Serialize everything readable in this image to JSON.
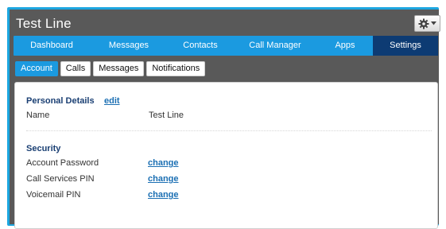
{
  "window": {
    "title": "Test Line"
  },
  "nav": {
    "items": [
      {
        "label": "Dashboard",
        "active": false
      },
      {
        "label": "Messages",
        "active": false
      },
      {
        "label": "Contacts",
        "active": false
      },
      {
        "label": "Call Manager",
        "active": false
      },
      {
        "label": "Apps",
        "active": false
      },
      {
        "label": "Settings",
        "active": true
      }
    ]
  },
  "subtabs": {
    "items": [
      {
        "label": "Account",
        "active": true
      },
      {
        "label": "Calls",
        "active": false
      },
      {
        "label": "Messages",
        "active": false
      },
      {
        "label": "Notifications",
        "active": false
      }
    ]
  },
  "personal": {
    "title": "Personal Details",
    "edit_label": "edit",
    "name_label": "Name",
    "name_value": "Test Line"
  },
  "security": {
    "title": "Security",
    "rows": [
      {
        "label": "Account Password",
        "action": "change"
      },
      {
        "label": "Call Services PIN",
        "action": "change"
      },
      {
        "label": "Voicemail PIN",
        "action": "change"
      }
    ]
  },
  "colors": {
    "accent": "#1b9ae0",
    "active_nav": "#0d3b73",
    "window_bg": "#595959",
    "section_title": "#1a3f73",
    "link": "#1b6fb3"
  },
  "icons": {
    "settings_menu": "gear-icon",
    "dropdown": "caret-down-icon"
  }
}
